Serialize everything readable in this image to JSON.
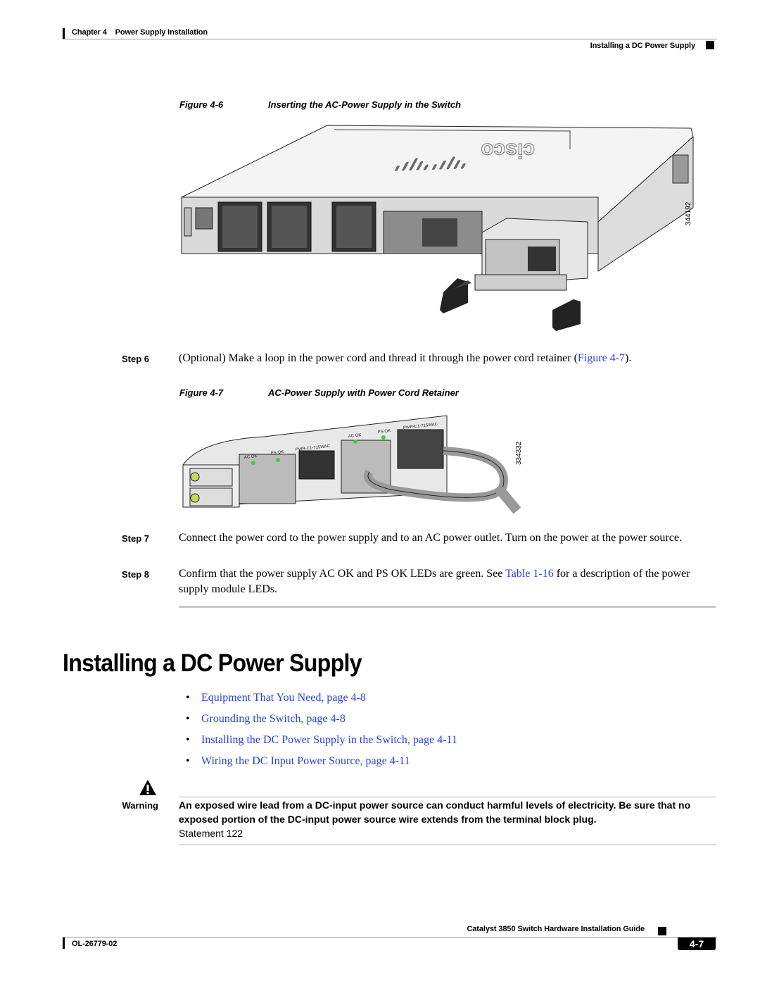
{
  "header": {
    "chapter_label": "Chapter 4",
    "chapter_title": "Power Supply Installation",
    "section_title": "Installing a DC Power Supply"
  },
  "figure6": {
    "label": "Figure 4-6",
    "title": "Inserting the AC-Power Supply in the Switch",
    "art_id": "344192",
    "brand_text": "cisco"
  },
  "step6": {
    "label": "Step 6",
    "text_before": "(Optional) Make a loop in the power cord and thread it through the power cord retainer (",
    "link": "Figure 4-7",
    "text_after": ")."
  },
  "figure7": {
    "label": "Figure 4-7",
    "title": "AC-Power Supply with Power Cord Retainer",
    "art_id": "334332",
    "left_psu": {
      "ac_ok": "AC OK",
      "ps_ok": "PS OK",
      "model": "PWR-C1-715WAC"
    },
    "right_psu": {
      "ac_ok": "AC OK",
      "ps_ok": "PS OK",
      "model": "PWR-C1-715WAC"
    }
  },
  "step7": {
    "label": "Step 7",
    "text": "Connect the power cord to the power supply and to an AC power outlet. Turn on the power at the power source."
  },
  "step8": {
    "label": "Step 8",
    "text_before": "Confirm that the power supply AC OK and PS OK LEDs are green. See ",
    "link": "Table 1-16",
    "text_after": " for a description of the power supply module LEDs."
  },
  "section": {
    "heading": "Installing a DC Power Supply",
    "bullets": [
      {
        "text": "Equipment That You Need, page 4-8"
      },
      {
        "text": "Grounding the Switch, page 4-8"
      },
      {
        "text": "Installing the DC Power Supply in the Switch, page 4-11"
      },
      {
        "text": "Wiring the DC Input Power Source, page 4-11"
      }
    ]
  },
  "warning": {
    "label": "Warning",
    "icon": "warning-triangle-icon",
    "text": "An exposed wire lead from a DC-input power source can conduct harmful levels of electricity. Be sure that no exposed portion of the DC-input power source wire extends from the terminal block plug.",
    "statement": "Statement 122"
  },
  "footer": {
    "guide_title": "Catalyst 3850 Switch Hardware Installation Guide",
    "doc_number": "OL-26779-02",
    "page_number": "4-7"
  },
  "colors": {
    "link": "#2a3fd6",
    "page_tab": "#000000"
  }
}
